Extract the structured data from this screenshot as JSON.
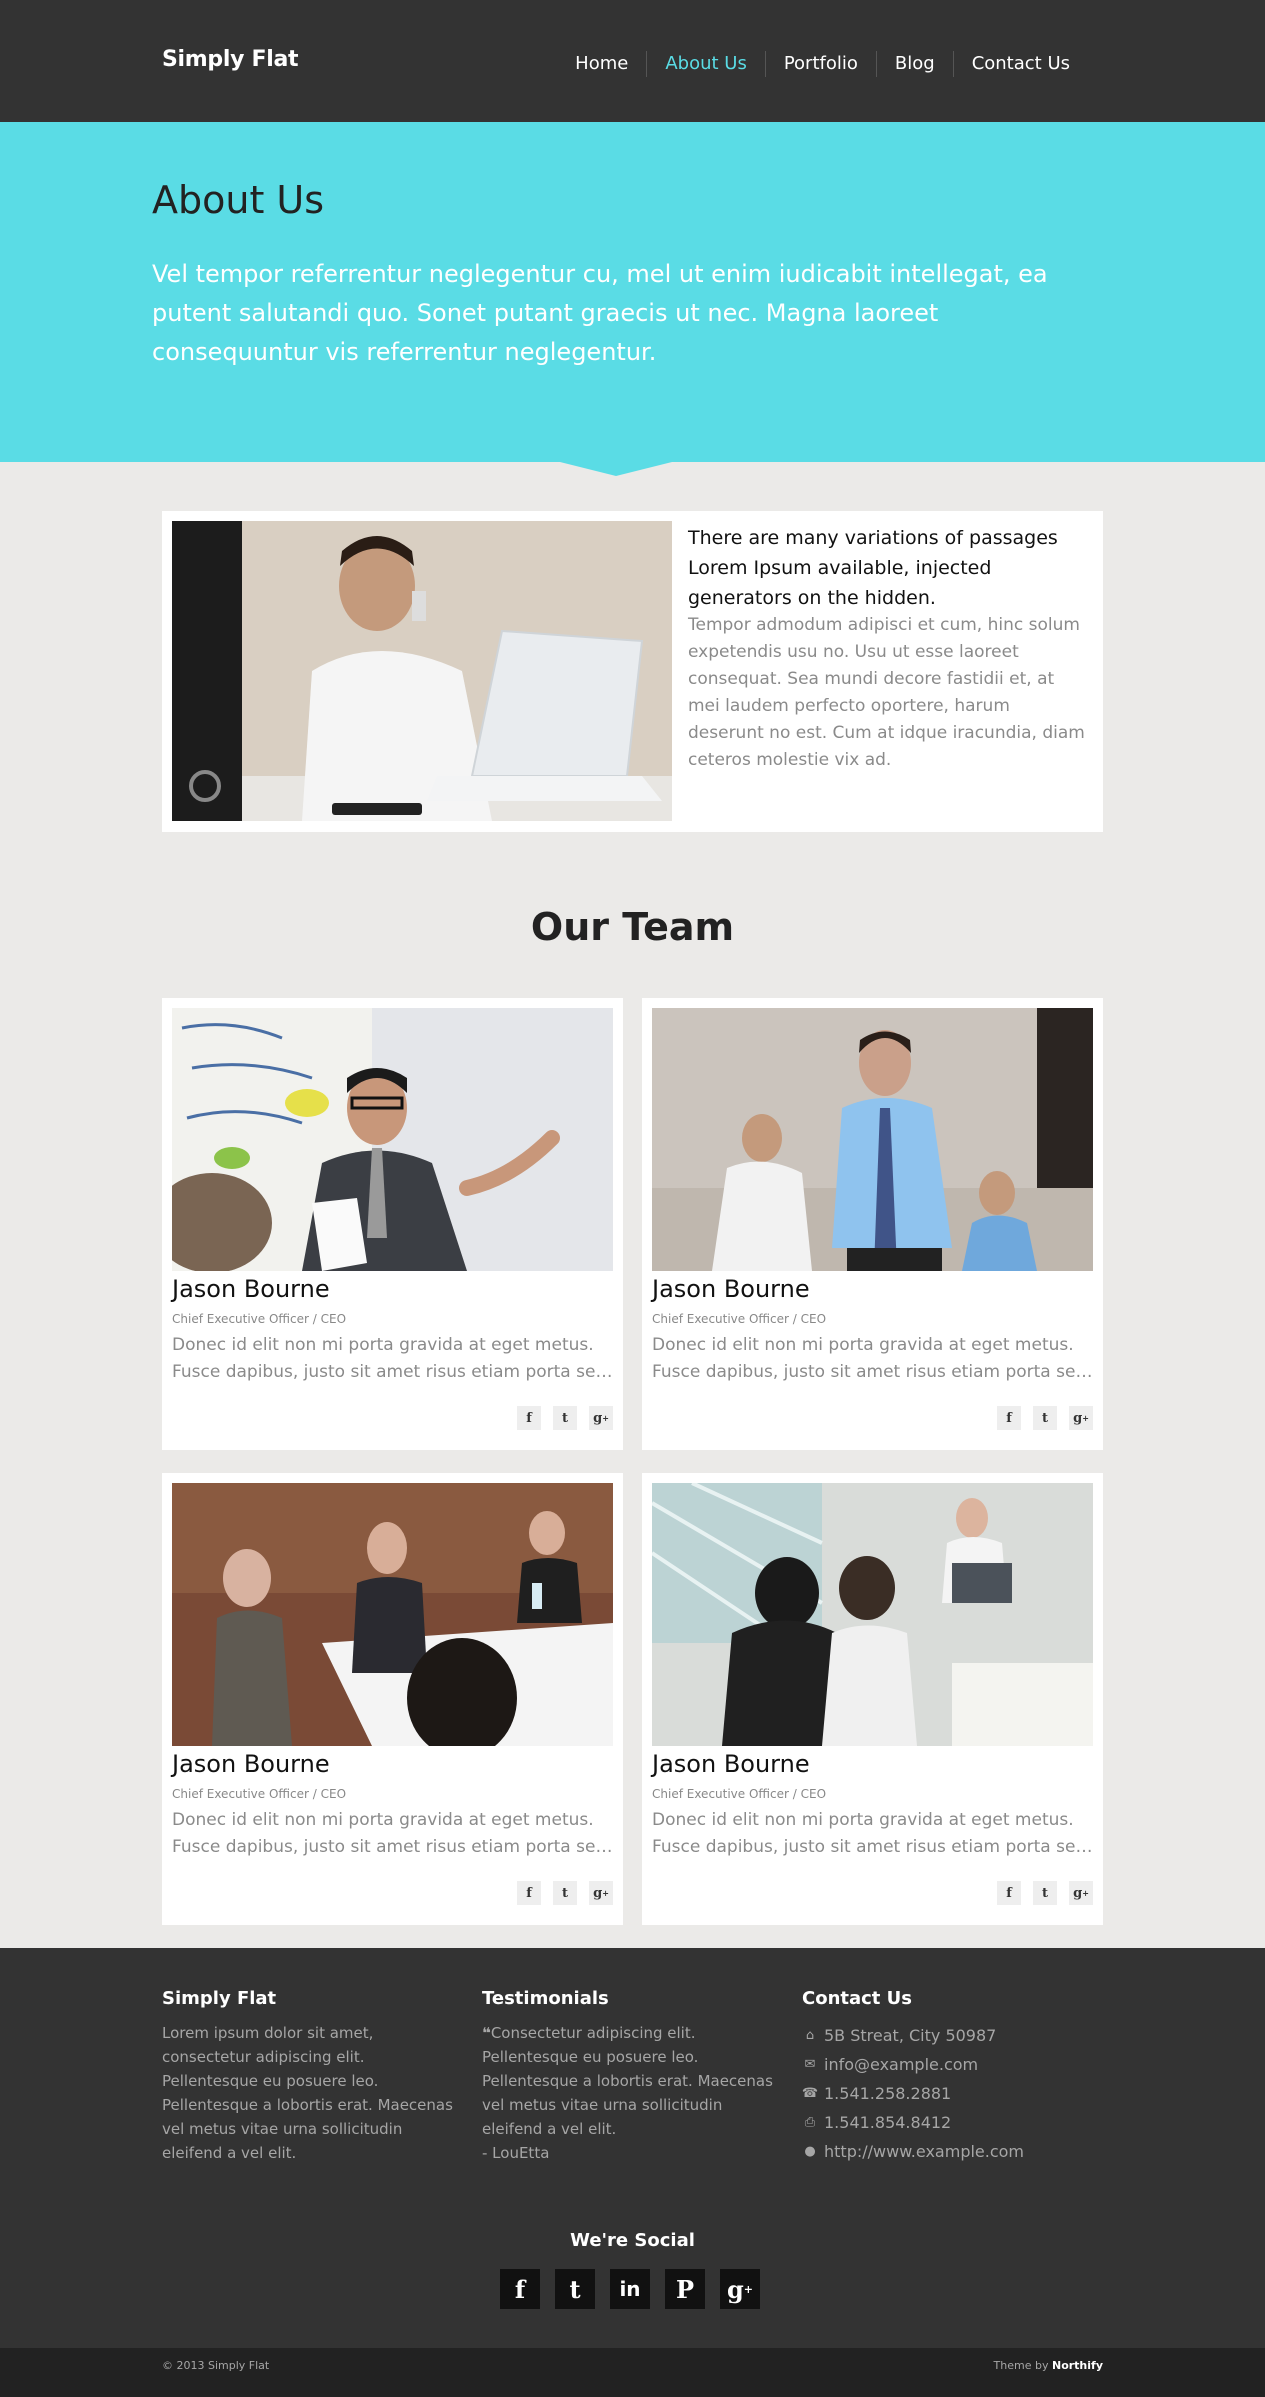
{
  "header": {
    "brand": "Simply Flat",
    "nav": [
      "Home",
      "About Us",
      "Portfolio",
      "Blog",
      "Contact Us"
    ],
    "active_nav": "About Us"
  },
  "hero": {
    "title": "About Us",
    "text": "Vel tempor referrentur neglegentur cu, mel ut enim iudicabit intellegat, ea putent salutandi quo. Sonet putant graecis ut nec. Magna laoreet consequuntur vis referrentur neglegentur."
  },
  "about": {
    "lead": "There are many variations of passages Lorem Ipsum available, injected generators on the hidden.",
    "body": "Tempor admodum adipisci et cum, hinc solum expetendis usu no. Usu ut esse laoreet consequat. Sea mundi decore fastidii et, at mei laudem perfecto oportere, harum deserunt no est. Cum at idque iracundia, diam ceteros molestie vix ad."
  },
  "team": {
    "title": "Our Team",
    "members": [
      {
        "name": "Jason Bourne",
        "role": "Chief Executive Officer / CEO",
        "bio1": "Donec id elit non mi porta gravida at eget metus.",
        "bio2": "Fusce dapibus, justo sit amet risus etiam porta sem..."
      },
      {
        "name": "Jason Bourne",
        "role": "Chief Executive Officer / CEO",
        "bio1": "Donec id elit non mi porta gravida at eget metus.",
        "bio2": "Fusce dapibus, justo sit amet risus etiam porta sem..."
      },
      {
        "name": "Jason Bourne",
        "role": "Chief Executive Officer / CEO",
        "bio1": "Donec id elit non mi porta gravida at eget metus.",
        "bio2": "Fusce dapibus, justo sit amet risus etiam porta sem..."
      },
      {
        "name": "Jason Bourne",
        "role": "Chief Executive Officer / CEO",
        "bio1": "Donec id elit non mi porta gravida at eget metus.",
        "bio2": "Fusce dapibus, justo sit amet risus etiam porta sem..."
      }
    ]
  },
  "footer": {
    "col1": {
      "title": "Simply Flat",
      "text": "Lorem ipsum dolor sit amet, consectetur adipiscing elit. Pellentesque eu posuere leo. Pellentesque a lobortis erat. Maecenas vel metus vitae urna sollicitudin eleifend a vel elit."
    },
    "col2": {
      "title": "Testimonials",
      "text": "Consectetur adipiscing elit. Pellentesque eu posuere leo. Pellentesque a lobortis erat. Maecenas vel metus vitae urna sollicitudin eleifend a vel elit.",
      "author": "- LouEtta"
    },
    "col3": {
      "title": "Contact Us",
      "address": "5B Streat, City 50987",
      "email": "info@example.com",
      "phone": "1.541.258.2881",
      "fax": "1.541.854.8412",
      "website": "http://www.example.com"
    },
    "social_title": "We're Social",
    "copyright": "© 2013 Simply Flat",
    "theme_prefix": "Theme by",
    "theme_author": "Northify"
  },
  "colors": {
    "accent": "#5adce5",
    "dark": "#333333",
    "darker": "#222222"
  }
}
